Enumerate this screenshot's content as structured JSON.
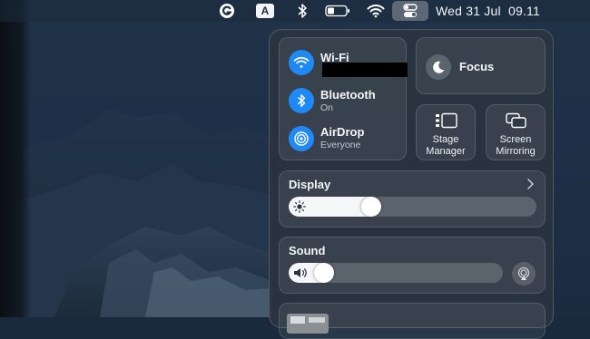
{
  "menubar": {
    "date": "Wed 31 Jul",
    "time": "09.11",
    "input_source": "A",
    "icons": [
      "grammarly-icon",
      "input-source-icon",
      "bluetooth-icon",
      "battery-icon",
      "wifi-icon",
      "control-center-icon"
    ]
  },
  "connectivity": {
    "wifi": {
      "title": "Wi-Fi",
      "status": "",
      "icon": "wifi-icon"
    },
    "bluetooth": {
      "title": "Bluetooth",
      "status": "On",
      "icon": "bluetooth-icon"
    },
    "airdrop": {
      "title": "AirDrop",
      "status": "Everyone",
      "icon": "airdrop-icon"
    }
  },
  "focus": {
    "label": "Focus",
    "icon": "moon-icon"
  },
  "stage_manager": {
    "line1": "Stage",
    "line2": "Manager",
    "icon": "stage-manager-icon"
  },
  "screen_mirroring": {
    "line1": "Screen",
    "line2": "Mirroring",
    "icon": "screen-mirroring-icon"
  },
  "display": {
    "label": "Display",
    "brightness_percent": 32
  },
  "sound": {
    "label": "Sound",
    "volume_percent": 13
  },
  "colors": {
    "accent": "#1f8af6",
    "panel": "#2a3440"
  }
}
